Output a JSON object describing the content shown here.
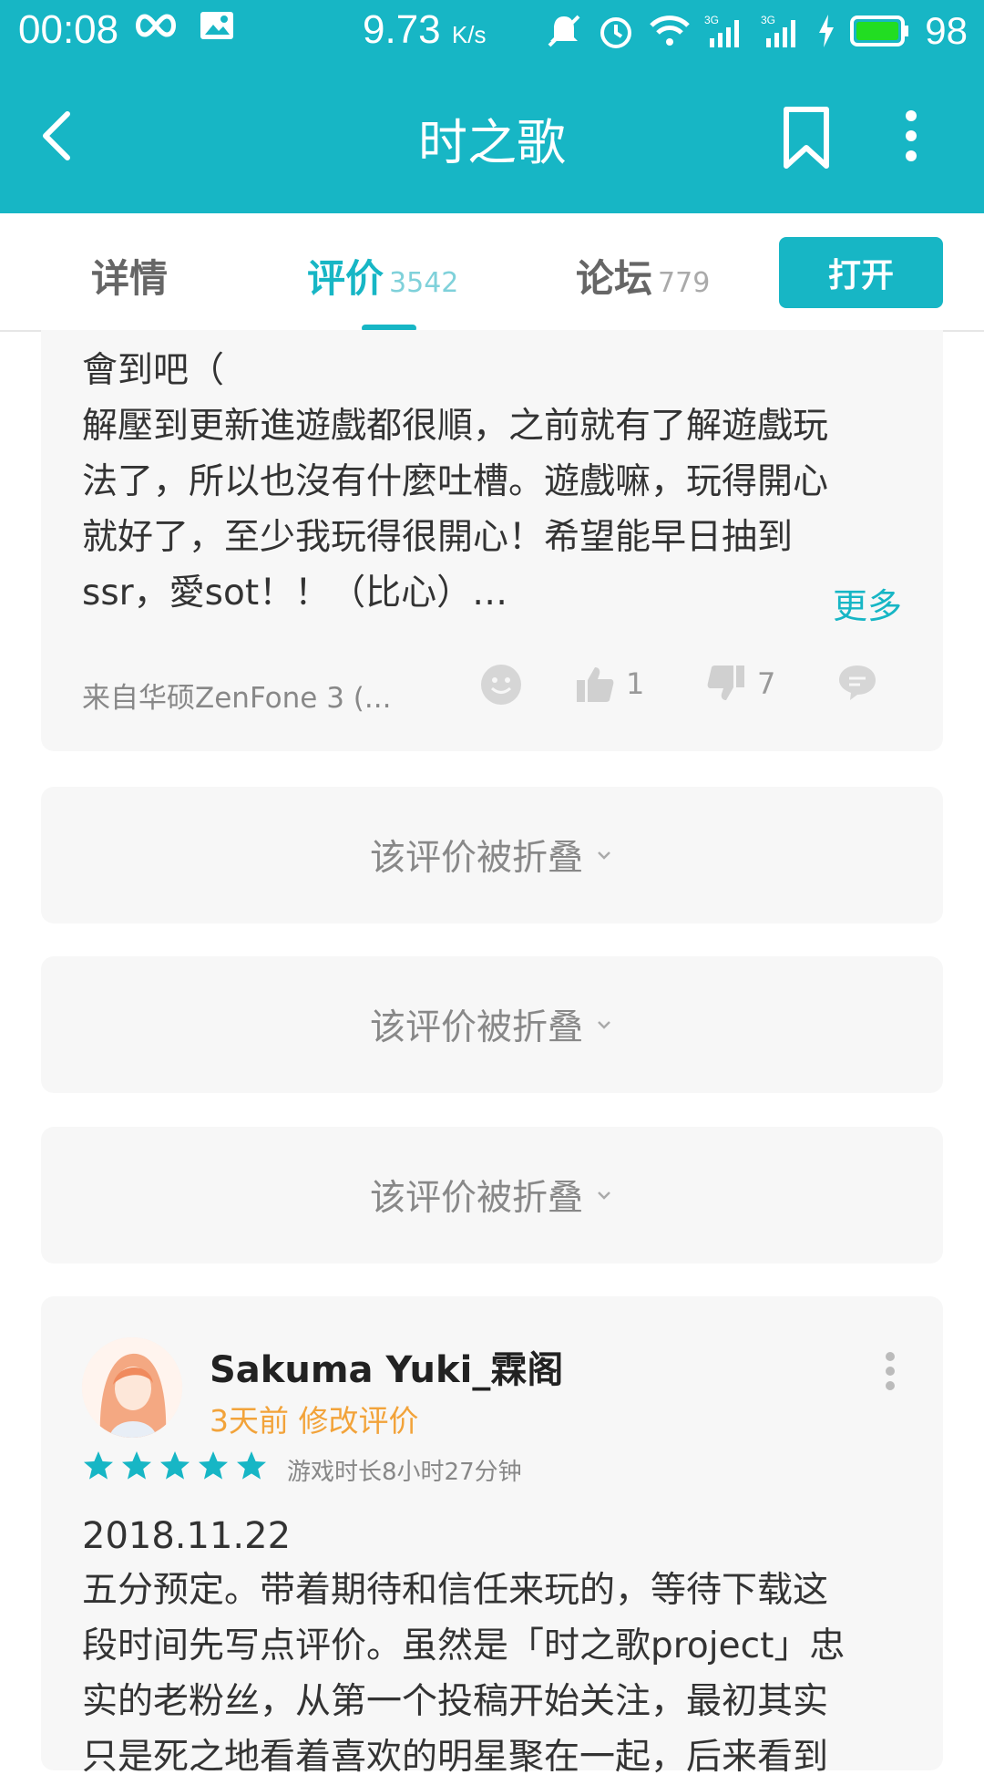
{
  "status_bar": {
    "time": "00:08",
    "speed_value": "9.73",
    "speed_unit": "K/s",
    "battery_level": "98",
    "icons": [
      "infinity-icon",
      "image-icon",
      "mute-icon",
      "alarm-icon",
      "wifi-icon",
      "signal-3g-icon",
      "signal-3g-icon",
      "charging-icon",
      "battery-icon"
    ]
  },
  "app_bar": {
    "title": "时之歌",
    "icons": [
      "back-icon",
      "bookmark-icon",
      "more-icon"
    ]
  },
  "tabs": [
    {
      "label": "详情",
      "count": ""
    },
    {
      "label": "评价",
      "count": "3542"
    },
    {
      "label": "论坛",
      "count": "779"
    }
  ],
  "open_button": "打开",
  "review_1": {
    "lines": [
      "會到吧（",
      "解壓到更新進遊戲都很順，之前就有了解遊戲玩",
      "法了，所以也沒有什麼吐槽。遊戲嘛，玩得開心",
      "就好了，至少我玩得很開心！希望能早日抽到",
      "ssr，愛sot！！（比心）…"
    ],
    "more_label": "更多",
    "device": "来自华硕ZenFone 3 (...",
    "likes": "1",
    "dislikes": "7"
  },
  "folded_label": "该评价被折叠",
  "review_2": {
    "username": "Sakuma Yuki_霖阁",
    "meta": "3天前 修改评价",
    "rating": 5,
    "playtime": "游戏时长8小时27分钟",
    "date": "2018.11.22",
    "lines": [
      "五分预定。带着期待和信任来玩的，等待下载这",
      "段时间先写点评价。虽然是「时之歌project」忠",
      "实的老粉丝，从第一个投稿开始关注，最初其实",
      "只是死之地看着喜欢的明星聚在一起，后来看到"
    ]
  },
  "colors": {
    "accent": "#17b6c5",
    "meta": "#f2a33a",
    "card": "#f7f7f7"
  }
}
